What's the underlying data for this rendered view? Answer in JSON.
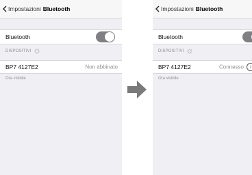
{
  "left": {
    "nav": {
      "back_label": "Impostazioni",
      "title": "Bluetooth"
    },
    "bluetooth_label": "Bluetooth",
    "bluetooth_on": true,
    "section_header": "DISPOSITIVI",
    "device": {
      "name": "BP7 4127E2",
      "status": "Non abbinato"
    },
    "visibility_text": "Ora visibile"
  },
  "right": {
    "nav": {
      "back_label": "Impostazioni",
      "title": "Bluetooth"
    },
    "bluetooth_label": "Bluetooth",
    "bluetooth_on": true,
    "section_header": "DISPOSITIVI",
    "device": {
      "name": "BP7 4127E2",
      "status": "Connesso",
      "info_glyph": "i"
    },
    "visibility_text": "Ora visibile"
  },
  "colors": {
    "toggle_on": "#7f7f84",
    "arrow": "#7a7a7a",
    "background": "#efeff4"
  }
}
